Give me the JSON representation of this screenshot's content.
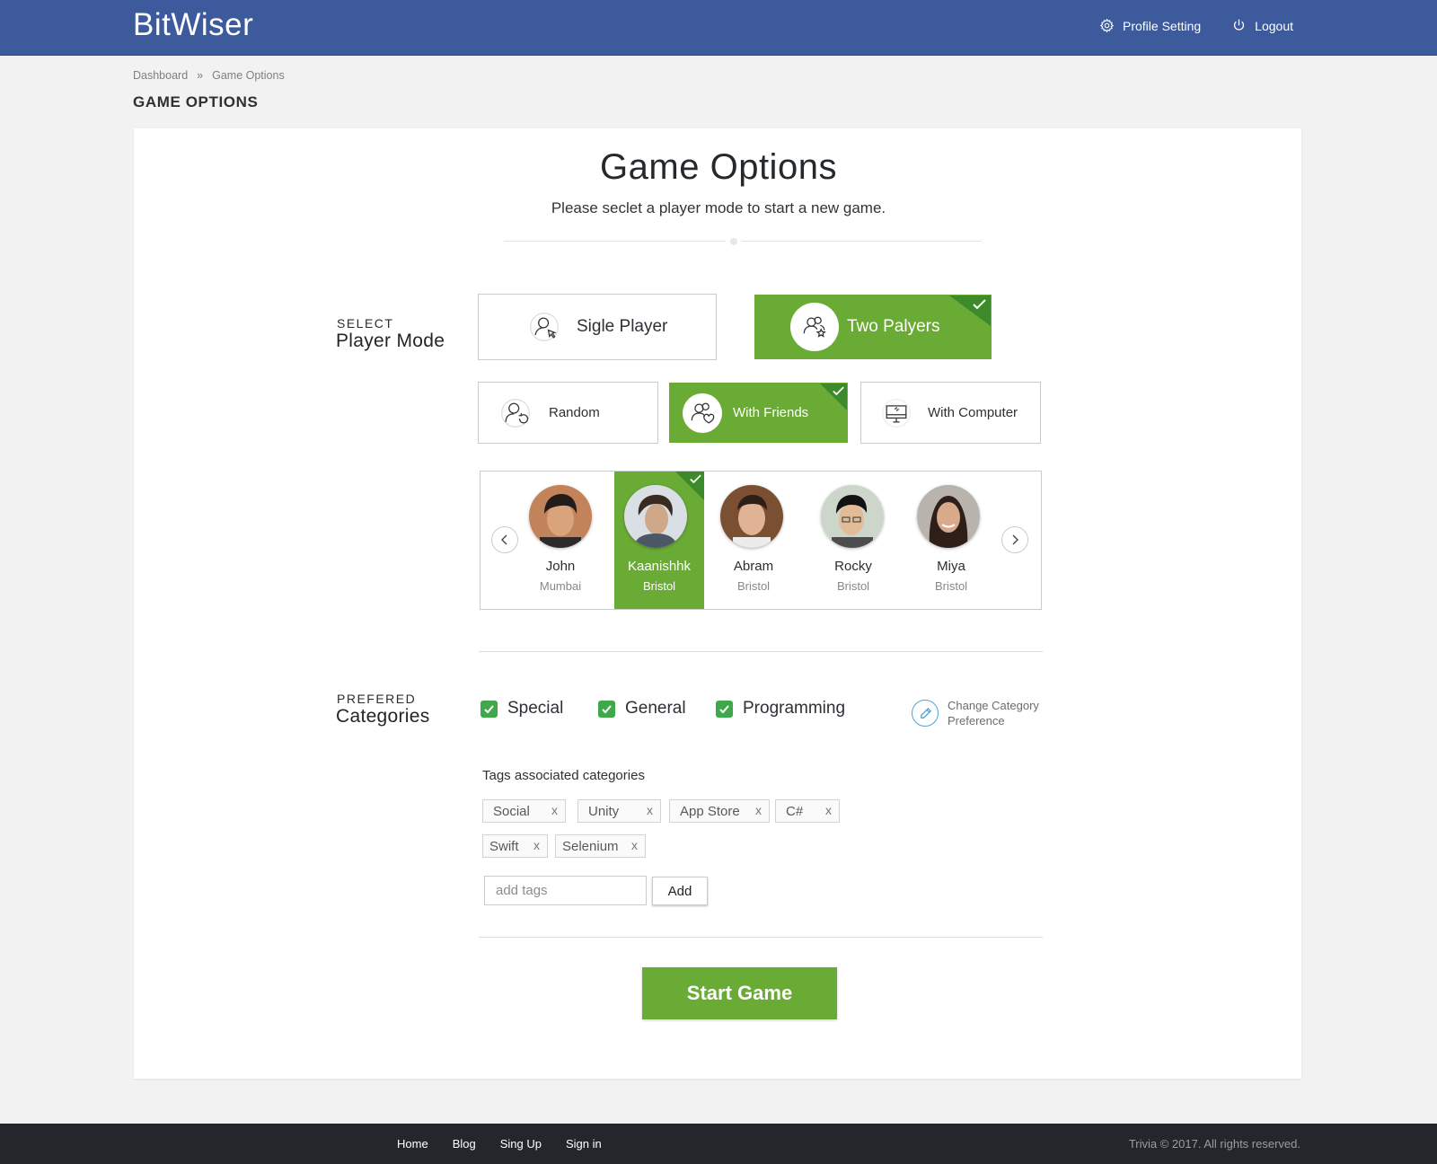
{
  "header": {
    "brand": "BitWiser",
    "nav": {
      "profile_setting": "Profile Setting",
      "logout": "Logout"
    }
  },
  "breadcrumb": {
    "home": "Dashboard",
    "separator": "»",
    "current": "Game Options"
  },
  "page_heading": "GAME OPTIONS",
  "card": {
    "title": "Game Options",
    "subtitle": "Please seclet a player mode to start a new game."
  },
  "player_mode": {
    "label_small": "SELECT",
    "label_big": "Player Mode",
    "modes": [
      {
        "label": "Sigle Player",
        "icon": "user-pointer-icon",
        "selected": false
      },
      {
        "label": "Two Palyers",
        "icon": "users-star-icon",
        "selected": true
      }
    ],
    "opponents": [
      {
        "label": "Random",
        "icon": "user-refresh-icon",
        "selected": false
      },
      {
        "label": "With Friends",
        "icon": "users-heart-icon",
        "selected": true
      },
      {
        "label": "With Computer",
        "icon": "monitor-icon",
        "selected": false
      }
    ]
  },
  "friends": [
    {
      "name": "John",
      "city": "Mumbai",
      "selected": false
    },
    {
      "name": "Kaanishhk",
      "city": "Bristol",
      "selected": true
    },
    {
      "name": "Abram",
      "city": "Bristol",
      "selected": false
    },
    {
      "name": "Rocky",
      "city": "Bristol",
      "selected": false
    },
    {
      "name": "Miya",
      "city": "Bristol",
      "selected": false
    }
  ],
  "categories": {
    "label_small": "PREFERED",
    "label_big": "Categories",
    "items": [
      {
        "label": "Special",
        "checked": true
      },
      {
        "label": "General",
        "checked": true
      },
      {
        "label": "Programming",
        "checked": true
      }
    ],
    "change_pref_line1": "Change Category",
    "change_pref_line2": "Preference"
  },
  "tags": {
    "label": "Tags associated categories",
    "items": [
      "Social",
      "Unity",
      "App Store",
      "C#",
      "Swift",
      "Selenium"
    ],
    "remove_glyph": "x",
    "input_placeholder": "add tags",
    "add_label": "Add"
  },
  "start_button": "Start Game",
  "footer": {
    "links": [
      "Home",
      "Blog",
      "Sing Up",
      "Sign in"
    ],
    "copyright": "Trivia © 2017. All rights reserved."
  },
  "colors": {
    "header_bg": "#3d5a9c",
    "accent_green": "#6aab36",
    "corner_green": "#3d8a2b",
    "checkbox_green": "#3fa84a",
    "footer_bg": "#23272b"
  }
}
